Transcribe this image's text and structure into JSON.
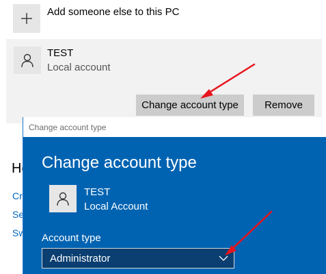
{
  "add_someone": {
    "label": "Add someone else to this PC",
    "icon": "plus-icon"
  },
  "account": {
    "name": "TEST",
    "type": "Local account",
    "icon": "person-icon",
    "change_button": "Change account type",
    "remove_button": "Remove"
  },
  "background": {
    "heading": "He",
    "links": [
      "Cr",
      "Se",
      "Sw"
    ]
  },
  "dialog": {
    "window_title": "Change account type",
    "heading": "Change account type",
    "account_name": "TEST",
    "account_type": "Local Account",
    "field_label": "Account type",
    "selected_value": "Administrator",
    "accent_color": "#0063b1"
  },
  "annotation_color": "#e8141b"
}
